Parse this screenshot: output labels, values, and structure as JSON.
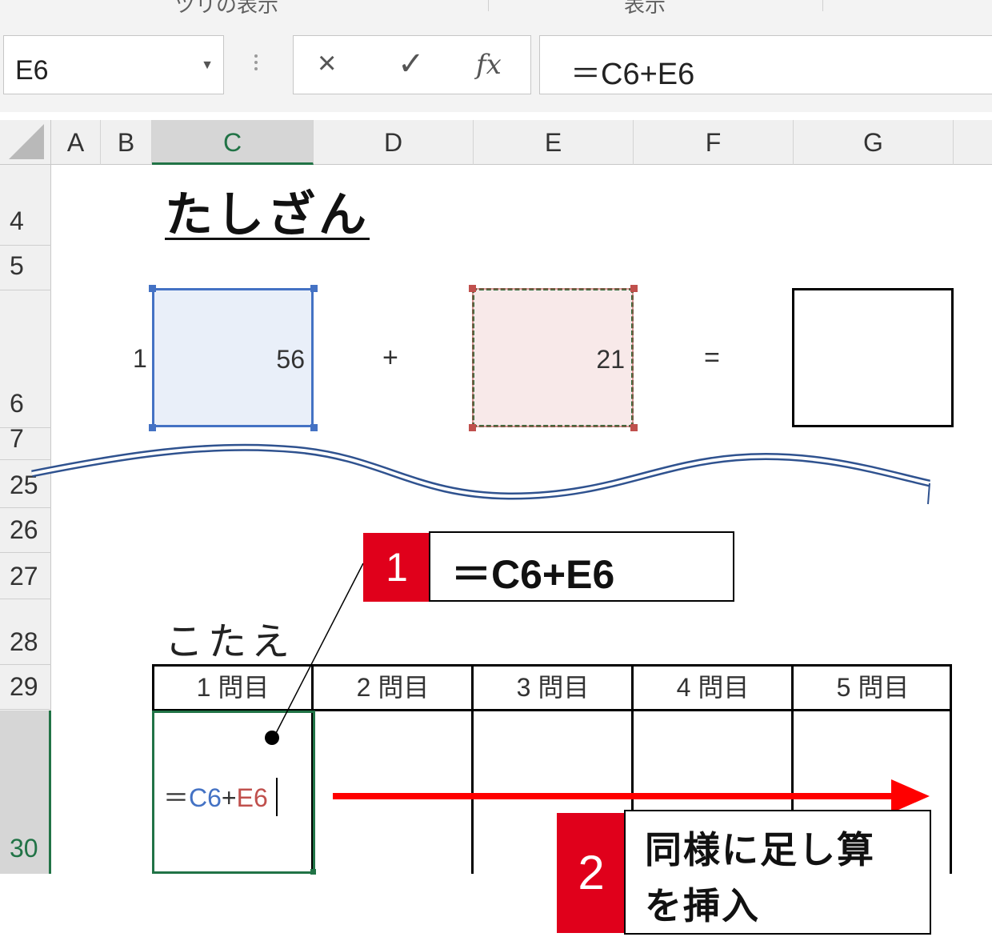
{
  "ribbon": {
    "group_left": "ツリの表示",
    "group_mid": "表示"
  },
  "formula_bar": {
    "name_box": "E6",
    "cancel_symbol": "×",
    "enter_symbol": "✓",
    "fx_label": "fx",
    "formula": "＝C6+E6"
  },
  "columns": [
    "A",
    "B",
    "C",
    "D",
    "E",
    "F",
    "G"
  ],
  "selected_column": "C",
  "rows": [
    "4",
    "5",
    "6",
    "7",
    "25",
    "26",
    "27",
    "28",
    "29",
    "30"
  ],
  "sheet": {
    "title": "たしざん",
    "b6": "1",
    "c6": "56",
    "plus": "+",
    "e6": "21",
    "equals": "=",
    "answer_label": "こたえ",
    "table_headers": [
      "1 問目",
      "2 問目",
      "3 問目",
      "4 問目",
      "5 問目"
    ],
    "editing_cell": {
      "prefix": "＝",
      "ref1": "C6",
      "plus": "+",
      "ref2": "E6"
    }
  },
  "callouts": {
    "c1": {
      "number": "1",
      "text": "＝C6+E6"
    },
    "c2": {
      "number": "2",
      "line1": "同様に足し算",
      "line2": "を挿入"
    }
  },
  "colors": {
    "excel_green": "#217346",
    "ref_blue": "#4472c4",
    "ref_red": "#c0504d",
    "callout_red": "#e0001b",
    "arrow_red": "#ff0000"
  }
}
